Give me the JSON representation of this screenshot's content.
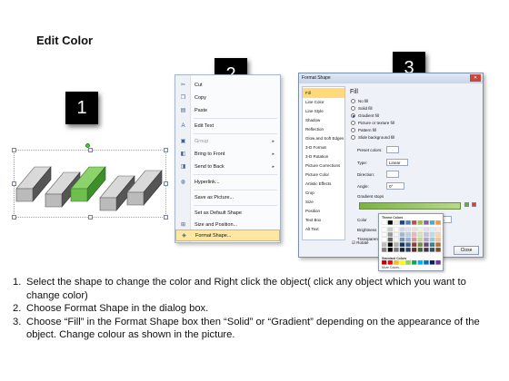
{
  "title": "Edit Color",
  "badges": [
    "1",
    "2",
    "3"
  ],
  "context_menu": {
    "items": [
      {
        "label": "Cut",
        "icon": "scissors-icon",
        "glyph": "✂",
        "disabled": false,
        "submenu": false,
        "highlight": false
      },
      {
        "label": "Copy",
        "icon": "copy-icon",
        "glyph": "❐",
        "disabled": false,
        "submenu": false,
        "highlight": false
      },
      {
        "label": "Paste",
        "icon": "paste-icon",
        "glyph": "📋",
        "disabled": false,
        "submenu": false,
        "highlight": false
      },
      {
        "label": "Edit Text",
        "icon": "edit-text-icon",
        "glyph": "A",
        "disabled": false,
        "submenu": false,
        "highlight": false
      },
      {
        "label": "Group",
        "icon": "group-icon",
        "glyph": "▣",
        "disabled": true,
        "submenu": true,
        "highlight": false
      },
      {
        "label": "Bring to Front",
        "icon": "bring-front-icon",
        "glyph": "◧",
        "disabled": false,
        "submenu": true,
        "highlight": false
      },
      {
        "label": "Send to Back",
        "icon": "send-back-icon",
        "glyph": "◨",
        "disabled": false,
        "submenu": true,
        "highlight": false
      },
      {
        "label": "Hyperlink...",
        "icon": "hyperlink-icon",
        "glyph": "🌐",
        "disabled": false,
        "submenu": false,
        "highlight": false
      },
      {
        "label": "Save as Picture...",
        "icon": "",
        "glyph": "",
        "disabled": false,
        "submenu": false,
        "highlight": false
      },
      {
        "label": "Set as Default Shape",
        "icon": "",
        "glyph": "",
        "disabled": false,
        "submenu": false,
        "highlight": false
      },
      {
        "label": "Size and Position...",
        "icon": "size-position-icon",
        "glyph": "⊞",
        "disabled": false,
        "submenu": false,
        "highlight": false
      },
      {
        "label": "Format Shape...",
        "icon": "format-shape-icon",
        "glyph": "◈",
        "disabled": false,
        "submenu": false,
        "highlight": true
      }
    ]
  },
  "dialog": {
    "title": "Format Shape",
    "close_label": "Close",
    "nav": [
      "Fill",
      "Line Color",
      "Line Style",
      "Shadow",
      "Reflection",
      "Glow and Soft Edges",
      "3-D Format",
      "3-D Rotation",
      "Picture Corrections",
      "Picture Color",
      "Artistic Effects",
      "Crop",
      "Size",
      "Position",
      "Text Box",
      "Alt Text"
    ],
    "section_title": "Fill",
    "fill_options": [
      {
        "label": "No fill",
        "selected": false
      },
      {
        "label": "Solid fill",
        "selected": false
      },
      {
        "label": "Gradient fill",
        "selected": true
      },
      {
        "label": "Picture or texture fill",
        "selected": false
      },
      {
        "label": "Pattern fill",
        "selected": false
      },
      {
        "label": "Slide background fill",
        "selected": false
      }
    ],
    "fields": {
      "preset_colors": "Preset colors:",
      "type_label": "Type:",
      "type_value": "Linear",
      "direction_label": "Direction:",
      "angle_label": "Angle:",
      "angle_value": "0°",
      "gradient_stops": "Gradient stops",
      "color_label": "Color",
      "position_label": "Position:",
      "position_value": "0%",
      "brightness_label": "Brightness",
      "transparency_label": "Transparency",
      "rotate_label": "Rotate"
    }
  },
  "palette": {
    "theme_label": "Theme Colors",
    "standard_label": "Standard Colors",
    "more_label": "More Colors...",
    "theme_top": [
      "#ffffff",
      "#000000",
      "#eeece1",
      "#1f497d",
      "#4f81bd",
      "#c0504d",
      "#9bbb59",
      "#8064a2",
      "#4bacc6",
      "#f79646"
    ],
    "standard": [
      "#c00000",
      "#ff0000",
      "#ffc000",
      "#ffff00",
      "#92d050",
      "#00b050",
      "#00b0f0",
      "#0070c0",
      "#002060",
      "#7030a0"
    ]
  },
  "steps": [
    {
      "num": "1.",
      "text": "Select the shape to change the color and Right click the object( click any object which you want to change color)"
    },
    {
      "num": "2.",
      "text": "Choose Format Shape in the dialog box."
    },
    {
      "num": "3.",
      "text": "Choose “Fill” in the Format Shape box then “Solid” or “Gradient” depending on the appearance of the object. Change colour as shown in the picture."
    }
  ]
}
